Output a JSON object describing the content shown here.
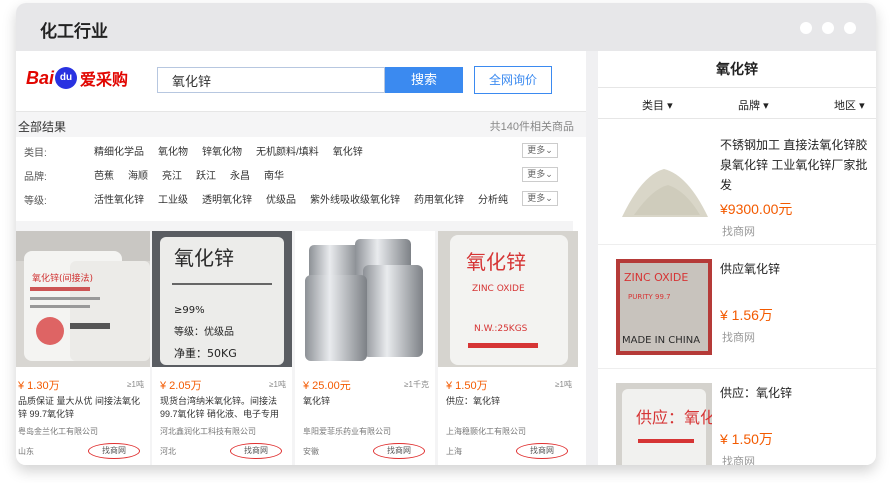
{
  "window": {
    "title": "化工行业"
  },
  "logo": {
    "brand_left": "Bai",
    "brand_paw": "du",
    "brand_right": "爱采购"
  },
  "search": {
    "value": "氧化锌",
    "button": "搜索",
    "inquiry_button": "全网询价"
  },
  "category_bar": {
    "all_label": "全部结果",
    "count_text": "共140件相关商品"
  },
  "filters": [
    {
      "label": "类目:",
      "options": [
        "精细化学品",
        "氧化物",
        "锌氧化物",
        "无机颜料/填料",
        "氧化锌"
      ],
      "more": "更多"
    },
    {
      "label": "品牌:",
      "options": [
        "芭蕉",
        "海顺",
        "亮江",
        "跃江",
        "永昌",
        "南华"
      ],
      "more": "更多"
    },
    {
      "label": "等级:",
      "options": [
        "活性氧化锌",
        "工业级",
        "透明氧化锌",
        "优级品",
        "紫外线吸收级氧化锌",
        "药用氧化锌",
        "分析纯"
      ],
      "more": "更多"
    }
  ],
  "cards": [
    {
      "price": "¥ 1.30万",
      "qty": "≥1吨",
      "name": "品质保证 量大从优 间接法氧化锌 99.7氧化锌",
      "company": "粤岛金兰化工有限公司",
      "location": "山东",
      "source": "找商网"
    },
    {
      "price": "¥ 2.05万",
      "qty": "≥1吨",
      "name": "现货台湾纳米氧化锌。间接法99.7氧化锌 硝化液、电子专用",
      "company": "河北鑫润化工科技有限公司",
      "location": "河北",
      "source": "找商网"
    },
    {
      "price": "¥ 25.00元",
      "qty": "≥1千克",
      "name": "氧化锌",
      "company": "阜阳爱菲乐药业有限公司",
      "location": "安徽",
      "source": "找商网"
    },
    {
      "price": "¥ 1.50万",
      "qty": "≥1吨",
      "name": "供应：氧化锌",
      "company": "上海稳颢化工有限公司",
      "location": "上海",
      "source": "找商网"
    }
  ],
  "card_image_text": {
    "c1": "氧化锌(间接法)",
    "c2a": "氧化锌",
    "c2b": "≥99%",
    "c2c": "等级：优级品",
    "c2d": "净重：50KG",
    "c4a": "氧化锌",
    "c4b": "ZINC OXIDE",
    "c4c": "N.W.:25KGS"
  },
  "right": {
    "title": "氧化锌",
    "filters": [
      "类目",
      "品牌",
      "地区"
    ],
    "items": [
      {
        "title": "不锈钢加工 直接法氧化锌胶泉氧化锌 工业氧化锌厂家批发",
        "price": "¥9300.00元",
        "source": "找商网"
      },
      {
        "title": "供应氧化锌",
        "price": "¥ 1.56万",
        "source": "找商网"
      },
      {
        "title": "供应：氧化锌",
        "price": "¥ 1.50万",
        "source": "找商网"
      }
    ],
    "item_image_text": {
      "zinc_oxide": "ZINC OXIDE",
      "purity": "PURITY 99.7",
      "made_in": "MADE IN CHINA"
    }
  }
}
